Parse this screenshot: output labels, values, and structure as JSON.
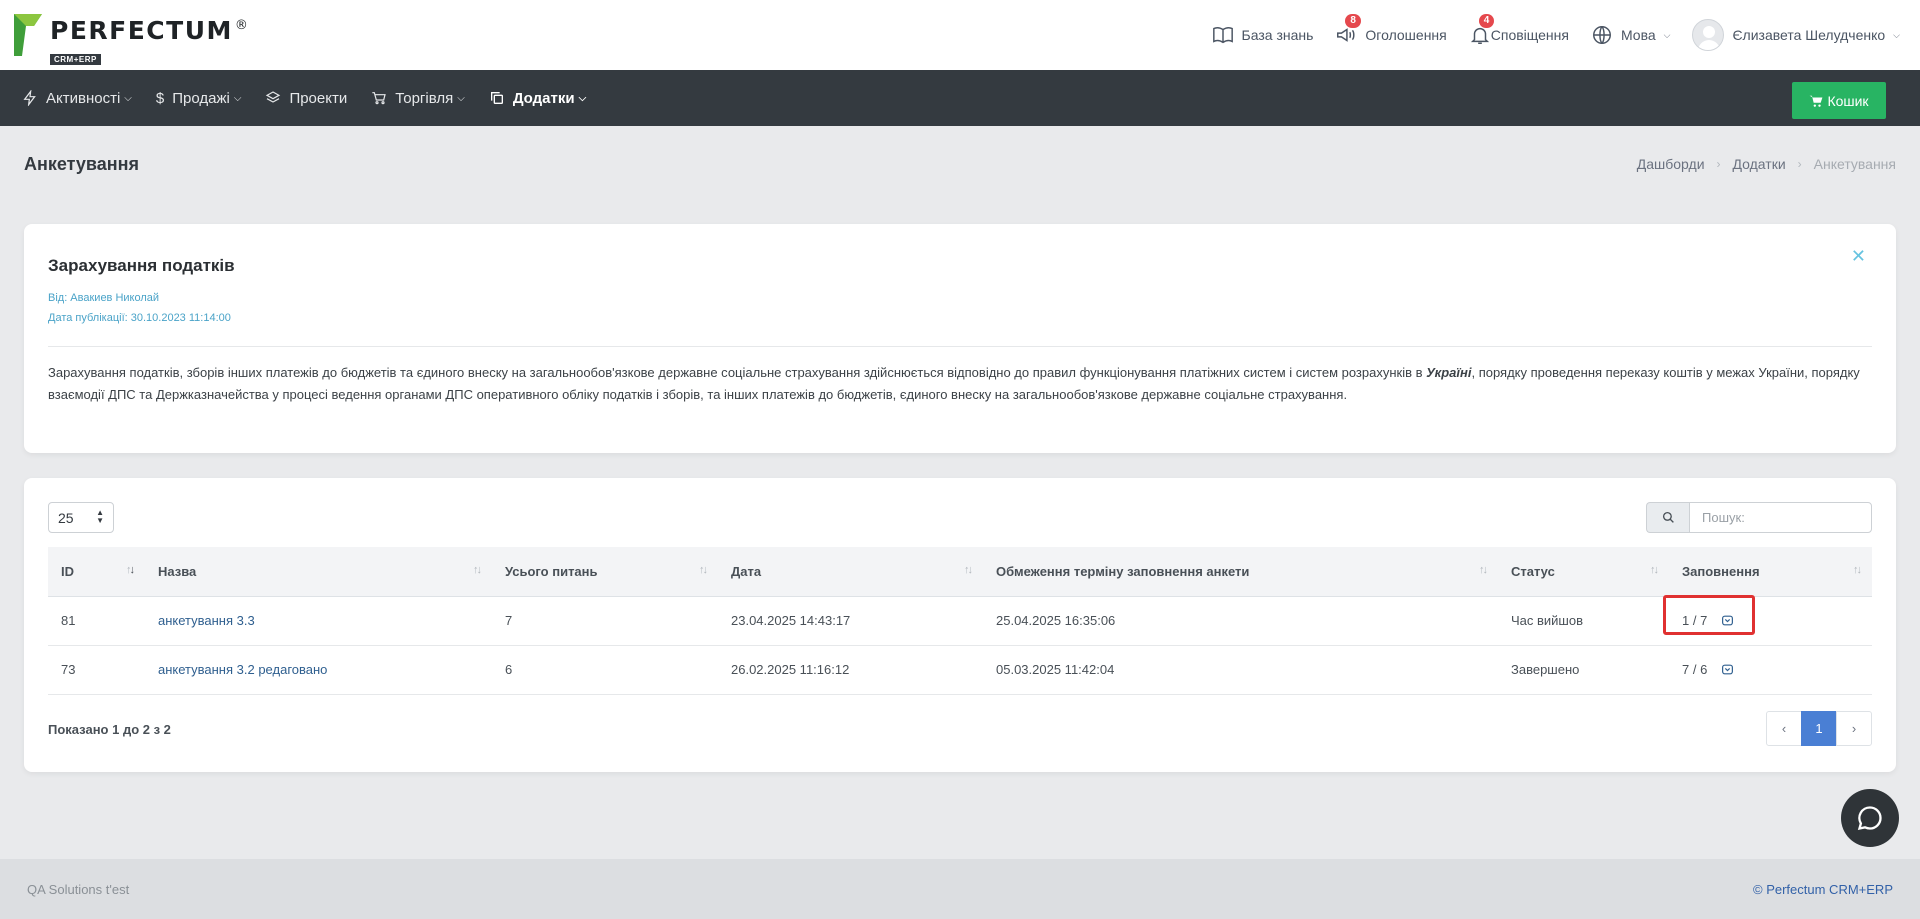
{
  "brand": {
    "name": "PERFECTUM",
    "reg": "®",
    "sub": "CRM+ERP"
  },
  "header": {
    "knowledge_base": "База знань",
    "announcements": "Оголошення",
    "announcements_count": "8",
    "notifications": "Сповіщення",
    "notifications_count": "4",
    "language": "Мова",
    "user_name": "Єлизавета Шелудченко"
  },
  "nav": {
    "items": [
      {
        "label": "Активності"
      },
      {
        "label": "Продажі"
      },
      {
        "label": "Проекти"
      },
      {
        "label": "Торгівля"
      },
      {
        "label": "Додатки"
      }
    ],
    "cart_label": "Кошик"
  },
  "page": {
    "title": "Анкетування",
    "breadcrumb": [
      "Дашборди",
      "Додатки",
      "Анкетування"
    ]
  },
  "announcement": {
    "title": "Зарахування податків",
    "from": "Від: Авакиев Николай",
    "published": "Дата публікації: 30.10.2023 11:14:00",
    "body_part1": "Зарахування податків, зборів інших платежів до бюджетів та єдиного внеску на загальнообов'язкове державне соціальне страхування здійснюється відповідно до правил функціонування платіжних систем і систем розрахунків в ",
    "body_italic": "Україні",
    "body_part2": ", порядку проведення переказу коштів у межах України, порядку взаємодії ДПС та Держказначейства у процесі ведення органами ДПС оперативного обліку податків і зборів, та інших платежів до бюджетів, єдиного внеску на загальнообов'язкове державне соціальне страхування."
  },
  "table": {
    "page_length": "25",
    "search_placeholder": "Пошук:",
    "columns": [
      "ID",
      "Назва",
      "Усього питань",
      "Дата",
      "Обмеження терміну заповнення анкети",
      "Статус",
      "Заповнення"
    ],
    "rows": [
      {
        "id": "81",
        "name": "анкетування 3.3",
        "total": "7",
        "date": "23.04.2025 14:43:17",
        "limit": "25.04.2025 16:35:06",
        "status": "Час вийшов",
        "fill": "1 / 7"
      },
      {
        "id": "73",
        "name": "анкетування 3.2 редаговано",
        "total": "6",
        "date": "26.02.2025 11:16:12",
        "limit": "05.03.2025 11:42:04",
        "status": "Завершено",
        "fill": "7 / 6"
      }
    ],
    "info": "Показано 1 до 2 з 2",
    "current_page": "1"
  },
  "footer": {
    "left": "QA Solutions t'est",
    "right": "© Perfectum CRM+ERP"
  },
  "colors": {
    "navbar": "#343a40",
    "cart_button": "#28b463",
    "highlight": "#e03131",
    "active_page": "#4a7fd4",
    "link": "#2f5f8f"
  }
}
